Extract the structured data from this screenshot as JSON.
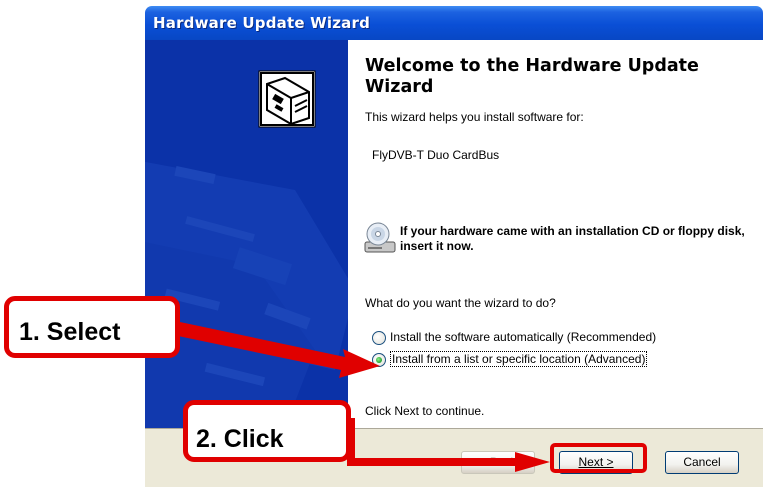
{
  "window": {
    "title": "Hardware Update Wizard"
  },
  "content": {
    "heading": "Welcome to the Hardware Update Wizard",
    "intro": "This wizard helps you install software for:",
    "device": "FlyDVB-T Duo CardBus",
    "cd_notice": "If your hardware came with an installation CD or floppy disk, insert it now.",
    "question": "What do you want the wizard to do?",
    "options": [
      {
        "label": "Install the software automatically (Recommended)",
        "selected": false
      },
      {
        "label": "Install from a list or specific location (Advanced)",
        "selected": true
      }
    ],
    "continue_text": "Click Next to continue."
  },
  "buttons": {
    "back": "< Back",
    "next": "Next >",
    "cancel": "Cancel"
  },
  "annotations": {
    "step1": "1. Select",
    "step2": "2. Click",
    "color": "#e00000"
  },
  "colors": {
    "titlebar": "#0a4fd6",
    "sidebar": "#0b32a8",
    "footer": "#ece9d8"
  },
  "icons": {
    "sidebar": "hardware-card-icon",
    "cd": "cd-drive-icon"
  }
}
